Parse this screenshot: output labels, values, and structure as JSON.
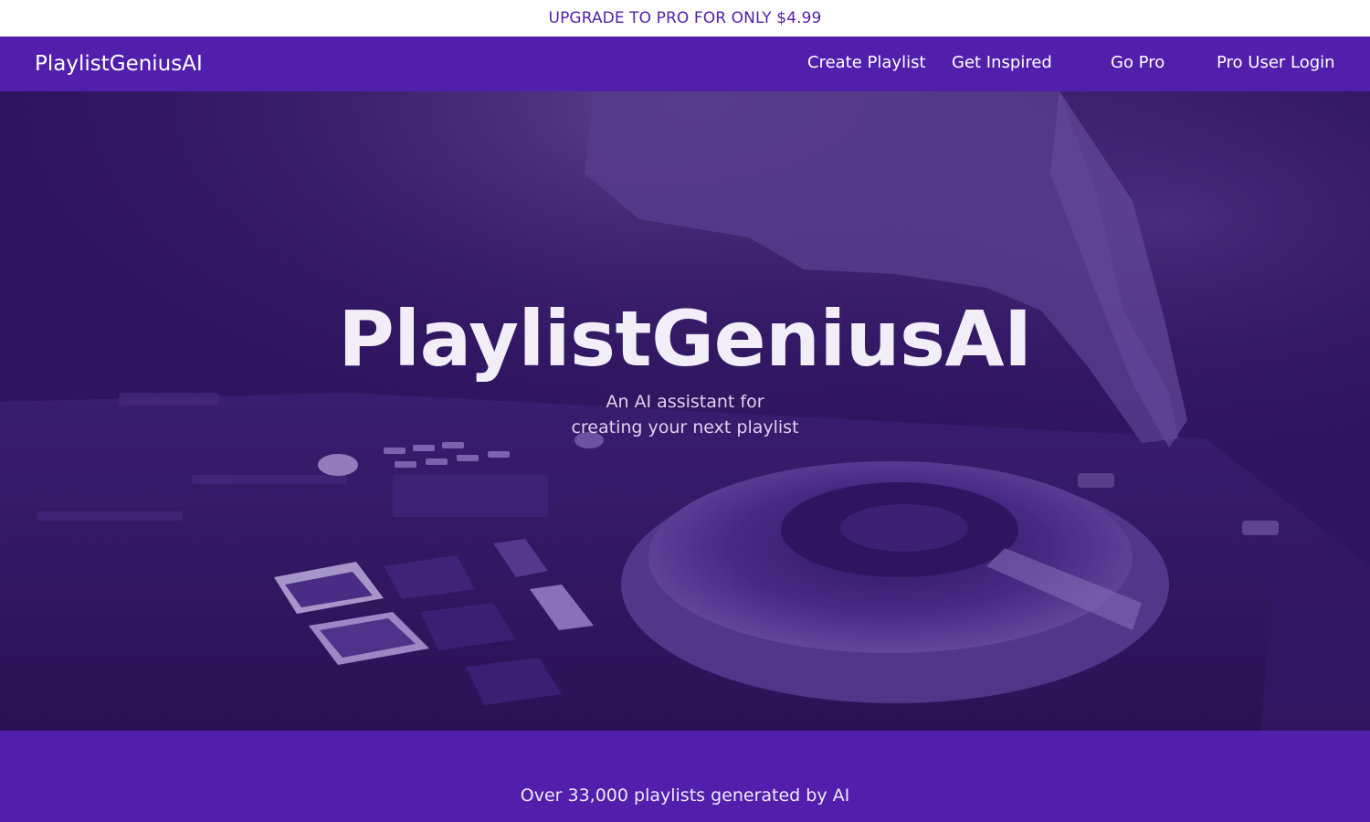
{
  "promo": {
    "text": "UPGRADE TO PRO FOR ONLY $4.99"
  },
  "navbar": {
    "brand": "PlaylistGeniusAI",
    "links": [
      {
        "label": "Create Playlist"
      },
      {
        "label": "Get Inspired"
      },
      {
        "label": "Go Pro"
      },
      {
        "label": "Pro User Login"
      }
    ]
  },
  "hero": {
    "title": "PlaylistGeniusAI",
    "subtitle_line1": "An AI assistant for",
    "subtitle_line2": "creating your next playlist",
    "background_image": "dj-controller-hand-photo"
  },
  "stats": {
    "text": "Over 33,000 playlists generated by AI"
  },
  "colors": {
    "brand_purple": "#521fac",
    "hero_overlay": "#2a1357",
    "promo_text": "#521fac"
  }
}
